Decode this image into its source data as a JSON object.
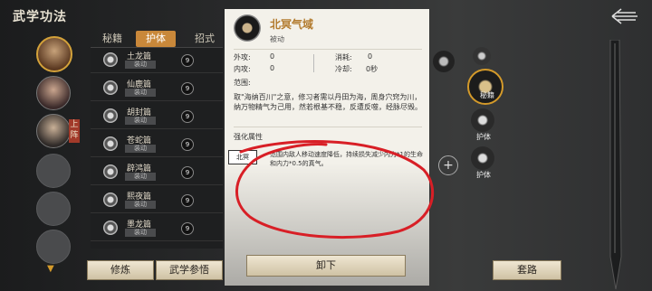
{
  "header": {
    "title": "武学功法"
  },
  "characters": {
    "active_badge": "上阵"
  },
  "tabs": [
    {
      "label": "秘籍"
    },
    {
      "label": "护体"
    },
    {
      "label": "招式"
    }
  ],
  "skills": [
    {
      "name": "土龙篇",
      "status": "装动",
      "count": "9"
    },
    {
      "name": "仙鹿篇",
      "status": "装动",
      "count": "9"
    },
    {
      "name": "胡封篇",
      "status": "装动",
      "count": "9"
    },
    {
      "name": "苍蛇篇",
      "status": "装动",
      "count": "9"
    },
    {
      "name": "辟鸿篇",
      "status": "装动",
      "count": "9"
    },
    {
      "name": "熙夜篇",
      "status": "装动",
      "count": "9"
    },
    {
      "name": "墨龙篇",
      "status": "装动",
      "count": "9"
    }
  ],
  "detail": {
    "name": "北冥气域",
    "type": "被动",
    "outer_atk_label": "外攻:",
    "outer_atk": "0",
    "inner_atk_label": "内攻:",
    "inner_atk": "0",
    "cost_label": "消耗:",
    "cost": "0",
    "cooldown_label": "冷却:",
    "cooldown": "0秒",
    "range_label": "范围:",
    "description": "取\"海纳百川\"之意，修习者需以丹田为海，周身穴窍为川，纳万物精气为己用，然若根基不稳，反遭反噬，经脉尽毁。",
    "enhance_label": "强化属性",
    "enhance_tag": "北冥",
    "effect": "范围内敌人移动速度降低，持续损失减少内力*1的生命和内力*0.5的真气。"
  },
  "right": {
    "slot_a_label": "护体",
    "slot_b_label": "护体",
    "side_label": "秘籍"
  },
  "buttons": {
    "cultivate": "修炼",
    "comprehend": "武学参悟",
    "unequip": "卸下",
    "routine": "套路"
  },
  "colors": {
    "accent": "#c9883a",
    "gold_border": "#d49a2a",
    "name_color": "#b27a2c"
  }
}
